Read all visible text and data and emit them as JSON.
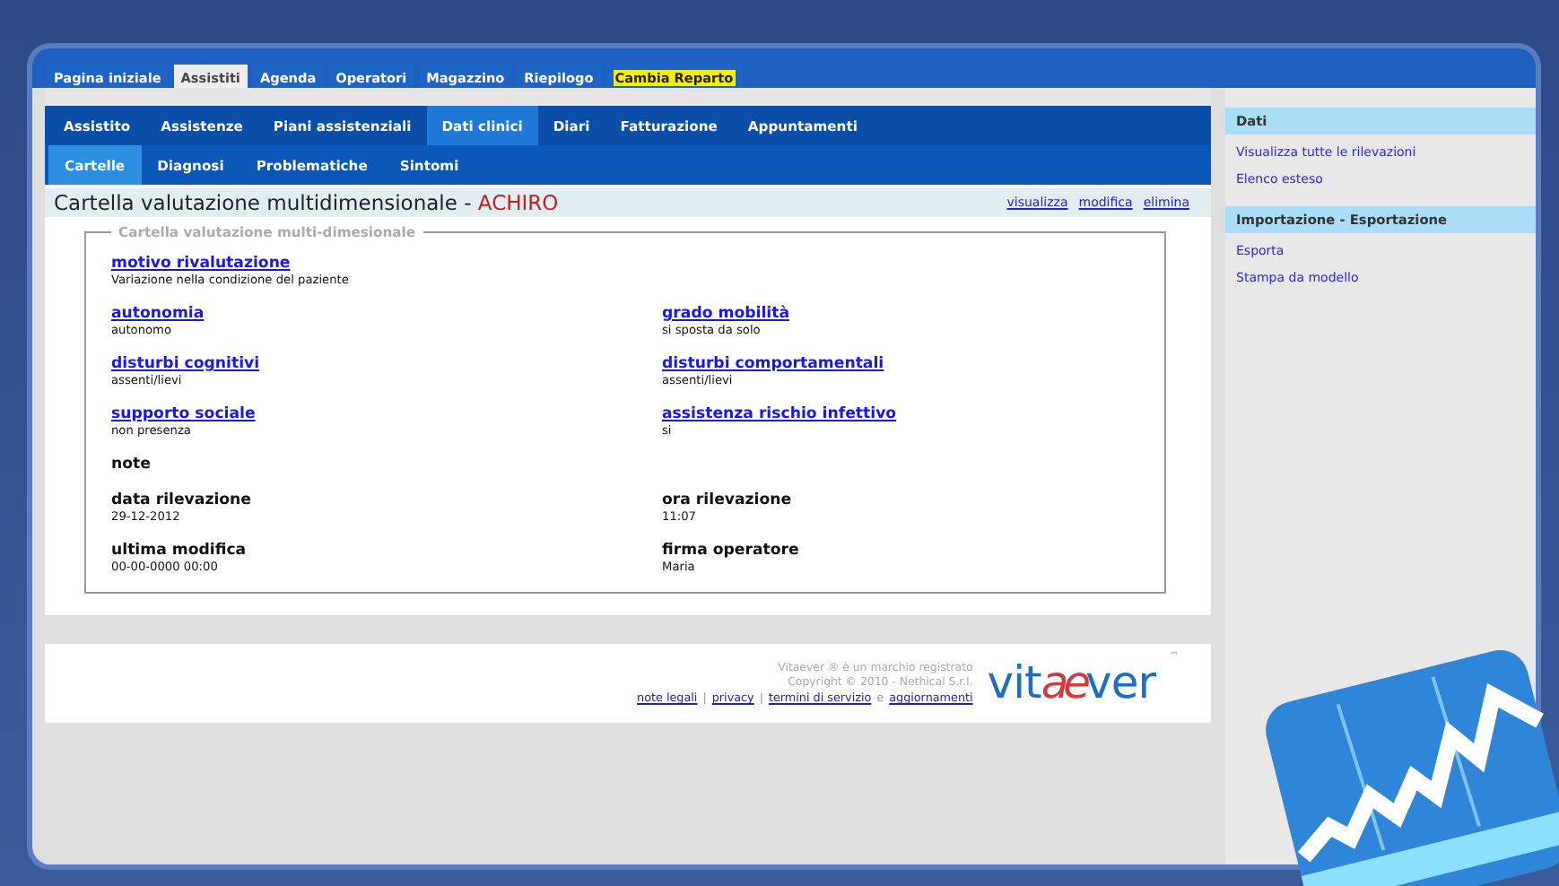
{
  "top_tabs": [
    {
      "label": "Pagina iniziale",
      "selected": false,
      "highlighted": false
    },
    {
      "label": "Assistiti",
      "selected": true,
      "highlighted": false
    },
    {
      "label": "Agenda",
      "selected": false,
      "highlighted": false
    },
    {
      "label": "Operatori",
      "selected": false,
      "highlighted": false
    },
    {
      "label": "Magazzino",
      "selected": false,
      "highlighted": false
    },
    {
      "label": "Riepilogo",
      "selected": false,
      "highlighted": false
    },
    {
      "label": "Cambia Reparto",
      "selected": false,
      "highlighted": true
    }
  ],
  "nav_tabs": [
    {
      "label": "Assistito",
      "selected": false
    },
    {
      "label": "Assistenze",
      "selected": false
    },
    {
      "label": "Piani assistenziali",
      "selected": false
    },
    {
      "label": "Dati clinici",
      "selected": true
    },
    {
      "label": "Diari",
      "selected": false
    },
    {
      "label": "Fatturazione",
      "selected": false
    },
    {
      "label": "Appuntamenti",
      "selected": false
    }
  ],
  "sub_tabs": [
    {
      "label": "Cartelle",
      "selected": true
    },
    {
      "label": "Diagnosi",
      "selected": false
    },
    {
      "label": "Problematiche",
      "selected": false
    },
    {
      "label": "Sintomi",
      "selected": false
    }
  ],
  "record": {
    "title": "Cartella valutazione multidimensionale - ",
    "patient": "ACHIRO",
    "actions": [
      "visualizza",
      "modifica",
      "elimina"
    ],
    "legend": "Cartella valutazione multi-dimesionale",
    "rows": [
      {
        "fields": [
          {
            "kind": "link",
            "label": "motivo rivalutazione",
            "value": "Variazione nella condizione del paziente"
          }
        ]
      },
      {
        "fields": [
          {
            "kind": "link",
            "label": "autonomia",
            "value": "autonomo"
          },
          {
            "kind": "link",
            "label": "grado mobilità",
            "value": "si sposta da solo"
          }
        ]
      },
      {
        "fields": [
          {
            "kind": "link",
            "label": "disturbi cognitivi",
            "value": "assenti/lievi"
          },
          {
            "kind": "link",
            "label": "disturbi comportamentali",
            "value": "assenti/lievi"
          }
        ]
      },
      {
        "fields": [
          {
            "kind": "link",
            "label": "supporto sociale",
            "value": "non presenza"
          },
          {
            "kind": "link",
            "label": "assistenza rischio infettivo",
            "value": "si"
          }
        ]
      },
      {
        "fields": [
          {
            "kind": "plain",
            "label": "note"
          }
        ]
      },
      {
        "fields": [
          {
            "kind": "plain",
            "label": "data rilevazione",
            "value": "29-12-2012"
          },
          {
            "kind": "plain",
            "label": "ora rilevazione",
            "value": "11:07"
          }
        ]
      },
      {
        "fields": [
          {
            "kind": "plain",
            "label": "ultima modifica",
            "value": "00-00-0000 00:00"
          },
          {
            "kind": "plain",
            "label": "firma operatore",
            "value": "Maria"
          }
        ]
      }
    ]
  },
  "sidebar": [
    {
      "heading": "Dati",
      "links": [
        "Visualizza tutte le rilevazioni",
        "Elenco esteso"
      ]
    },
    {
      "heading": "Importazione - Esportazione",
      "links": [
        "Esporta",
        "Stampa da modello"
      ]
    }
  ],
  "footer": {
    "notice": [
      "Vitaever ® è un marchio registrato",
      "Copyright © 2010 - Nethical S.r.l."
    ],
    "links": [
      {
        "kind": "link",
        "text": "note legali"
      },
      {
        "kind": "sep",
        "text": "|"
      },
      {
        "kind": "link",
        "text": "privacy"
      },
      {
        "kind": "sep",
        "text": "|"
      },
      {
        "kind": "link",
        "text": "termini di servizio"
      },
      {
        "kind": "sep",
        "text": "e"
      },
      {
        "kind": "link",
        "text": "aggiornamenti"
      }
    ],
    "logo": [
      "vit",
      "ae",
      "ver"
    ],
    "trademark": "™"
  }
}
